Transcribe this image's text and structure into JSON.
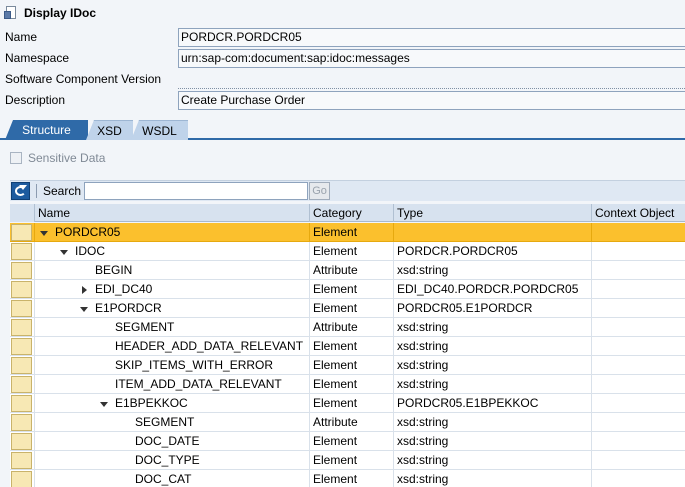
{
  "title": "Display IDoc",
  "fields": [
    {
      "label": "Name",
      "value": "PORDCR.PORDCR05"
    },
    {
      "label": "Namespace",
      "value": "urn:sap-com:document:sap:idoc:messages"
    },
    {
      "label": "Software Component Version",
      "value": ""
    },
    {
      "label": "Description",
      "value": "Create Purchase Order"
    }
  ],
  "tabs": [
    "Structure",
    "XSD",
    "WSDL"
  ],
  "sensitive_label": "Sensitive Data",
  "toolbar": {
    "search_label": "Search",
    "search_value": "",
    "go_label": "Go"
  },
  "columns": [
    "Name",
    "Category",
    "Type",
    "Context Object"
  ],
  "rows": [
    {
      "name": "PORDCR05",
      "category": "Element",
      "type": "",
      "context": "",
      "level": 0,
      "toggle": "down",
      "selected": true
    },
    {
      "name": "IDOC",
      "category": "Element",
      "type": "PORDCR.PORDCR05",
      "context": "",
      "level": 1,
      "toggle": "down",
      "selected": false
    },
    {
      "name": "BEGIN",
      "category": "Attribute",
      "type": "xsd:string",
      "context": "",
      "level": 2,
      "toggle": "none",
      "selected": false
    },
    {
      "name": "EDI_DC40",
      "category": "Element",
      "type": "EDI_DC40.PORDCR.PORDCR05",
      "context": "",
      "level": 2,
      "toggle": "right",
      "selected": false
    },
    {
      "name": "E1PORDCR",
      "category": "Element",
      "type": "PORDCR05.E1PORDCR",
      "context": "",
      "level": 2,
      "toggle": "down",
      "selected": false
    },
    {
      "name": "SEGMENT",
      "category": "Attribute",
      "type": "xsd:string",
      "context": "",
      "level": 3,
      "toggle": "none",
      "selected": false
    },
    {
      "name": "HEADER_ADD_DATA_RELEVANT",
      "category": "Element",
      "type": "xsd:string",
      "context": "",
      "level": 3,
      "toggle": "none",
      "selected": false
    },
    {
      "name": "SKIP_ITEMS_WITH_ERROR",
      "category": "Element",
      "type": "xsd:string",
      "context": "",
      "level": 3,
      "toggle": "none",
      "selected": false
    },
    {
      "name": "ITEM_ADD_DATA_RELEVANT",
      "category": "Element",
      "type": "xsd:string",
      "context": "",
      "level": 3,
      "toggle": "none",
      "selected": false
    },
    {
      "name": "E1BPEKKOC",
      "category": "Element",
      "type": "PORDCR05.E1BPEKKOC",
      "context": "",
      "level": 3,
      "toggle": "down",
      "selected": false
    },
    {
      "name": "SEGMENT",
      "category": "Attribute",
      "type": "xsd:string",
      "context": "",
      "level": 4,
      "toggle": "none",
      "selected": false
    },
    {
      "name": "DOC_DATE",
      "category": "Element",
      "type": "xsd:string",
      "context": "",
      "level": 4,
      "toggle": "none",
      "selected": false
    },
    {
      "name": "DOC_TYPE",
      "category": "Element",
      "type": "xsd:string",
      "context": "",
      "level": 4,
      "toggle": "none",
      "selected": false
    },
    {
      "name": "DOC_CAT",
      "category": "Element",
      "type": "xsd:string",
      "context": "",
      "level": 4,
      "toggle": "none",
      "selected": false
    }
  ]
}
